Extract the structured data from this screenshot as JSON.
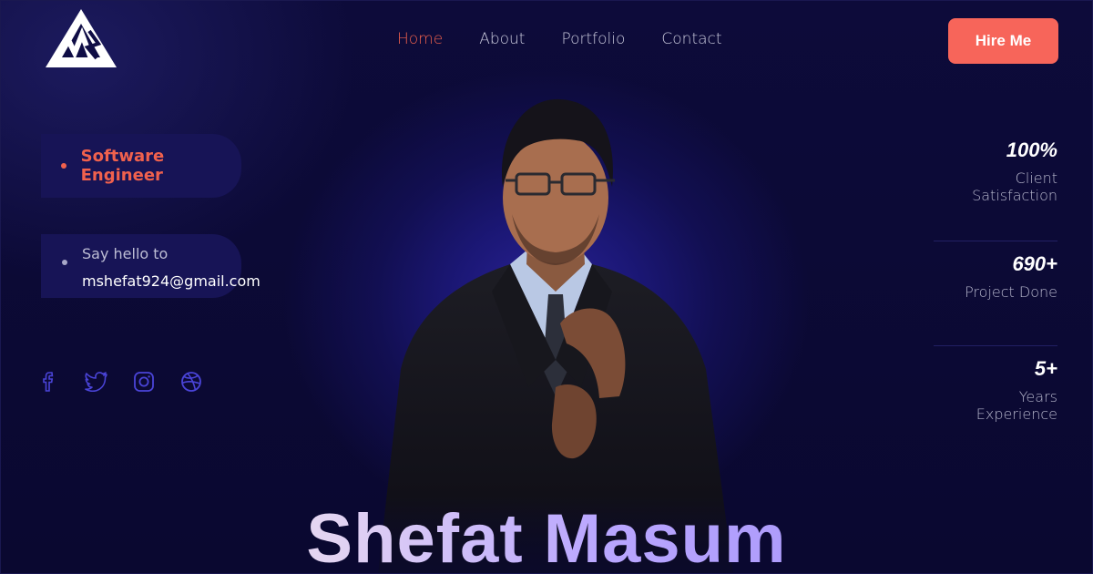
{
  "header": {
    "logo_icon": "ms-triangle-logo",
    "nav": [
      {
        "label": "Home",
        "active": true
      },
      {
        "label": "About",
        "active": false
      },
      {
        "label": "Portfolio",
        "active": false
      },
      {
        "label": "Contact",
        "active": false
      }
    ],
    "cta_label": "Hire Me"
  },
  "profile": {
    "role": "Software Engineer",
    "hello_label": "Say hello to",
    "email": "mshefat924@gmail.com",
    "name": "Shefat Masum"
  },
  "socials": [
    {
      "icon": "facebook-icon"
    },
    {
      "icon": "twitter-icon"
    },
    {
      "icon": "instagram-icon"
    },
    {
      "icon": "dribbble-icon"
    }
  ],
  "stats": [
    {
      "value": "100%",
      "label": "Client Satisfaction"
    },
    {
      "value": "690+",
      "label": "Project Done"
    },
    {
      "value": "5+",
      "label": "Years Experience"
    }
  ],
  "colors": {
    "accent": "#f7655a",
    "background": "#0a0830",
    "glow": "#2a2296",
    "social_icon": "#4a44d8"
  }
}
